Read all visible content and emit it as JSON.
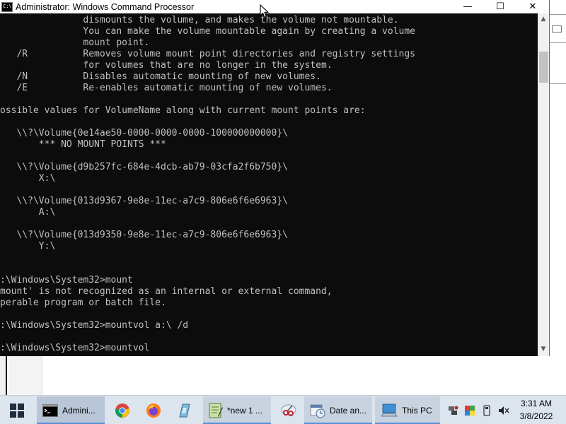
{
  "window": {
    "title": "Administrator: Windows Command Processor",
    "icon_label": "C:\\",
    "minimize": "—",
    "maximize": "☐",
    "close": "✕"
  },
  "console": {
    "lines": [
      "               dismounts the volume, and makes the volume not mountable.",
      "               You can make the volume mountable again by creating a volume",
      "               mount point.",
      "   /R          Removes volume mount point directories and registry settings",
      "               for volumes that are no longer in the system.",
      "   /N          Disables automatic mounting of new volumes.",
      "   /E          Re-enables automatic mounting of new volumes.",
      "",
      "ossible values for VolumeName along with current mount points are:",
      "",
      "   \\\\?\\Volume{0e14ae50-0000-0000-0000-100000000000}\\",
      "       *** NO MOUNT POINTS ***",
      "",
      "   \\\\?\\Volume{d9b257fc-684e-4dcb-ab79-03cfa2f6b750}\\",
      "       X:\\",
      "",
      "   \\\\?\\Volume{013d9367-9e8e-11ec-a7c9-806e6f6e6963}\\",
      "       A:\\",
      "",
      "   \\\\?\\Volume{013d9350-9e8e-11ec-a7c9-806e6f6e6963}\\",
      "       Y:\\",
      "",
      "",
      ":\\Windows\\System32>mount",
      "mount' is not recognized as an internal or external command,",
      "perable program or batch file.",
      "",
      ":\\Windows\\System32>mountvol a:\\ /d",
      "",
      ":\\Windows\\System32>mountvol"
    ]
  },
  "scrollbar": {
    "up": "▲",
    "down": "▼"
  },
  "taskbar": {
    "start_icon": "windows-logo",
    "items": [
      {
        "label": "Admini...",
        "icon": "cmd-icon"
      },
      {
        "label": "",
        "icon": "chrome-icon"
      },
      {
        "label": "",
        "icon": "firefox-icon"
      },
      {
        "label": "",
        "icon": "app-icon"
      },
      {
        "label": "*new 1 ...",
        "icon": "notepad-icon"
      },
      {
        "label": "",
        "icon": "snipping-icon"
      },
      {
        "label": "Date an...",
        "icon": "date-time-icon"
      },
      {
        "label": "This PC",
        "icon": "this-pc-icon"
      }
    ],
    "clock_time": "3:31 AM",
    "clock_date": "3/8/2022"
  },
  "colors": {
    "console_bg": "#0c0c0c",
    "console_text": "#c0c0c0",
    "taskbar_bg": "#dce4ee",
    "accent": "#5a8fd6"
  }
}
